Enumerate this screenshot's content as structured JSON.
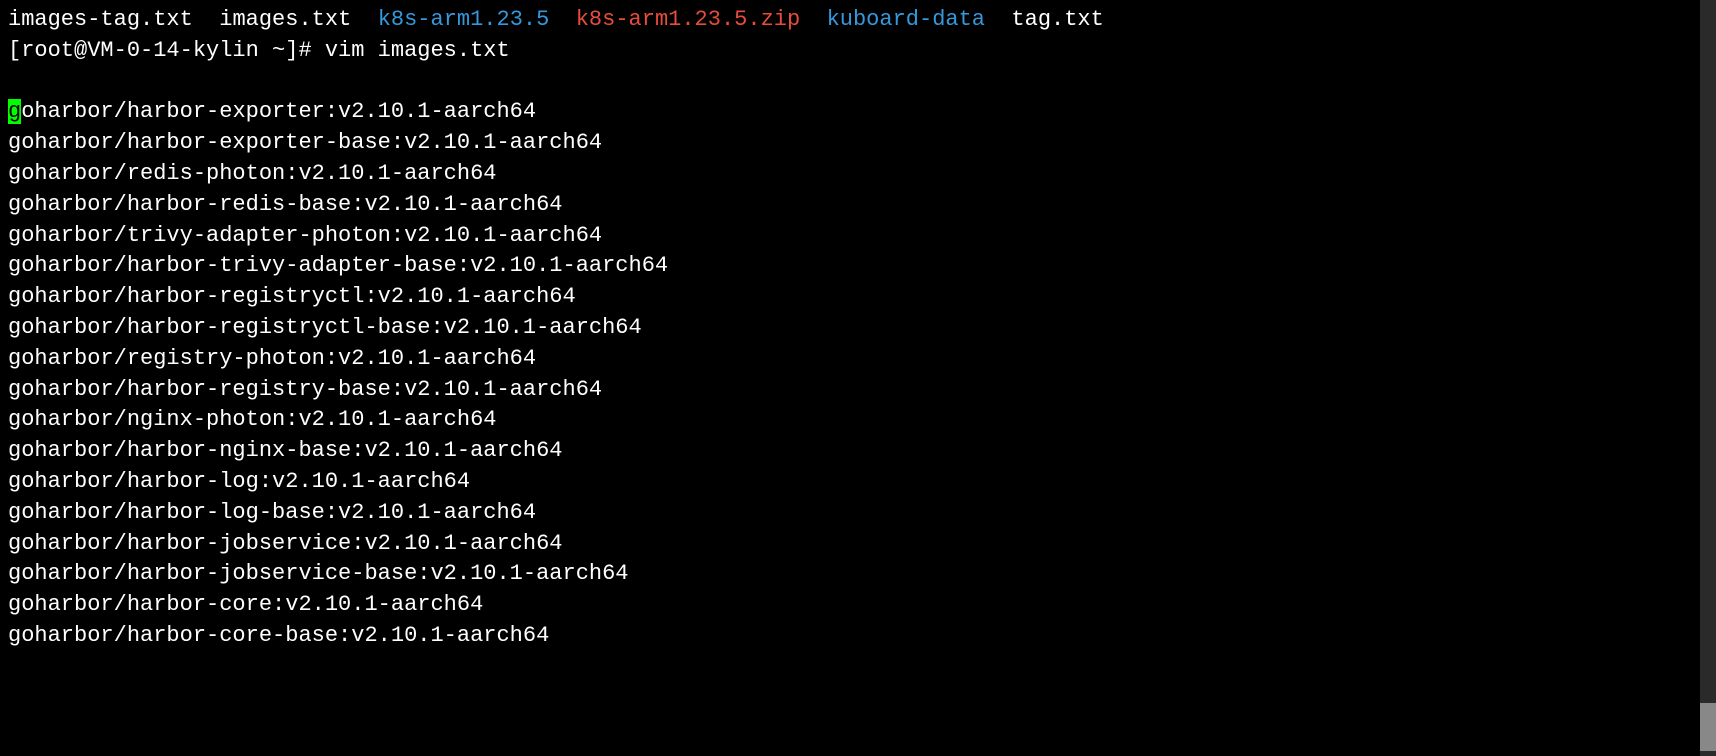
{
  "ls": {
    "items": [
      {
        "name": "images-tag.txt",
        "color": "white"
      },
      {
        "name": "images.txt",
        "color": "white"
      },
      {
        "name": "k8s-arm1.23.5",
        "color": "blue"
      },
      {
        "name": "k8s-arm1.23.5.zip",
        "color": "red"
      },
      {
        "name": "kuboard-data",
        "color": "blue"
      },
      {
        "name": "tag.txt",
        "color": "white"
      }
    ]
  },
  "prompt": {
    "text": "[root@VM-0-14-kylin ~]# ",
    "command": "vim images.txt"
  },
  "vim": {
    "cursor_first_char": "g",
    "first_line_rest": "oharbor/harbor-exporter:v2.10.1-aarch64",
    "lines": [
      "goharbor/harbor-exporter-base:v2.10.1-aarch64",
      "goharbor/redis-photon:v2.10.1-aarch64",
      "goharbor/harbor-redis-base:v2.10.1-aarch64",
      "goharbor/trivy-adapter-photon:v2.10.1-aarch64",
      "goharbor/harbor-trivy-adapter-base:v2.10.1-aarch64",
      "goharbor/harbor-registryctl:v2.10.1-aarch64",
      "goharbor/harbor-registryctl-base:v2.10.1-aarch64",
      "goharbor/registry-photon:v2.10.1-aarch64",
      "goharbor/harbor-registry-base:v2.10.1-aarch64",
      "goharbor/nginx-photon:v2.10.1-aarch64",
      "goharbor/harbor-nginx-base:v2.10.1-aarch64",
      "goharbor/harbor-log:v2.10.1-aarch64",
      "goharbor/harbor-log-base:v2.10.1-aarch64",
      "goharbor/harbor-jobservice:v2.10.1-aarch64",
      "goharbor/harbor-jobservice-base:v2.10.1-aarch64",
      "goharbor/harbor-core:v2.10.1-aarch64",
      "goharbor/harbor-core-base:v2.10.1-aarch64"
    ]
  }
}
